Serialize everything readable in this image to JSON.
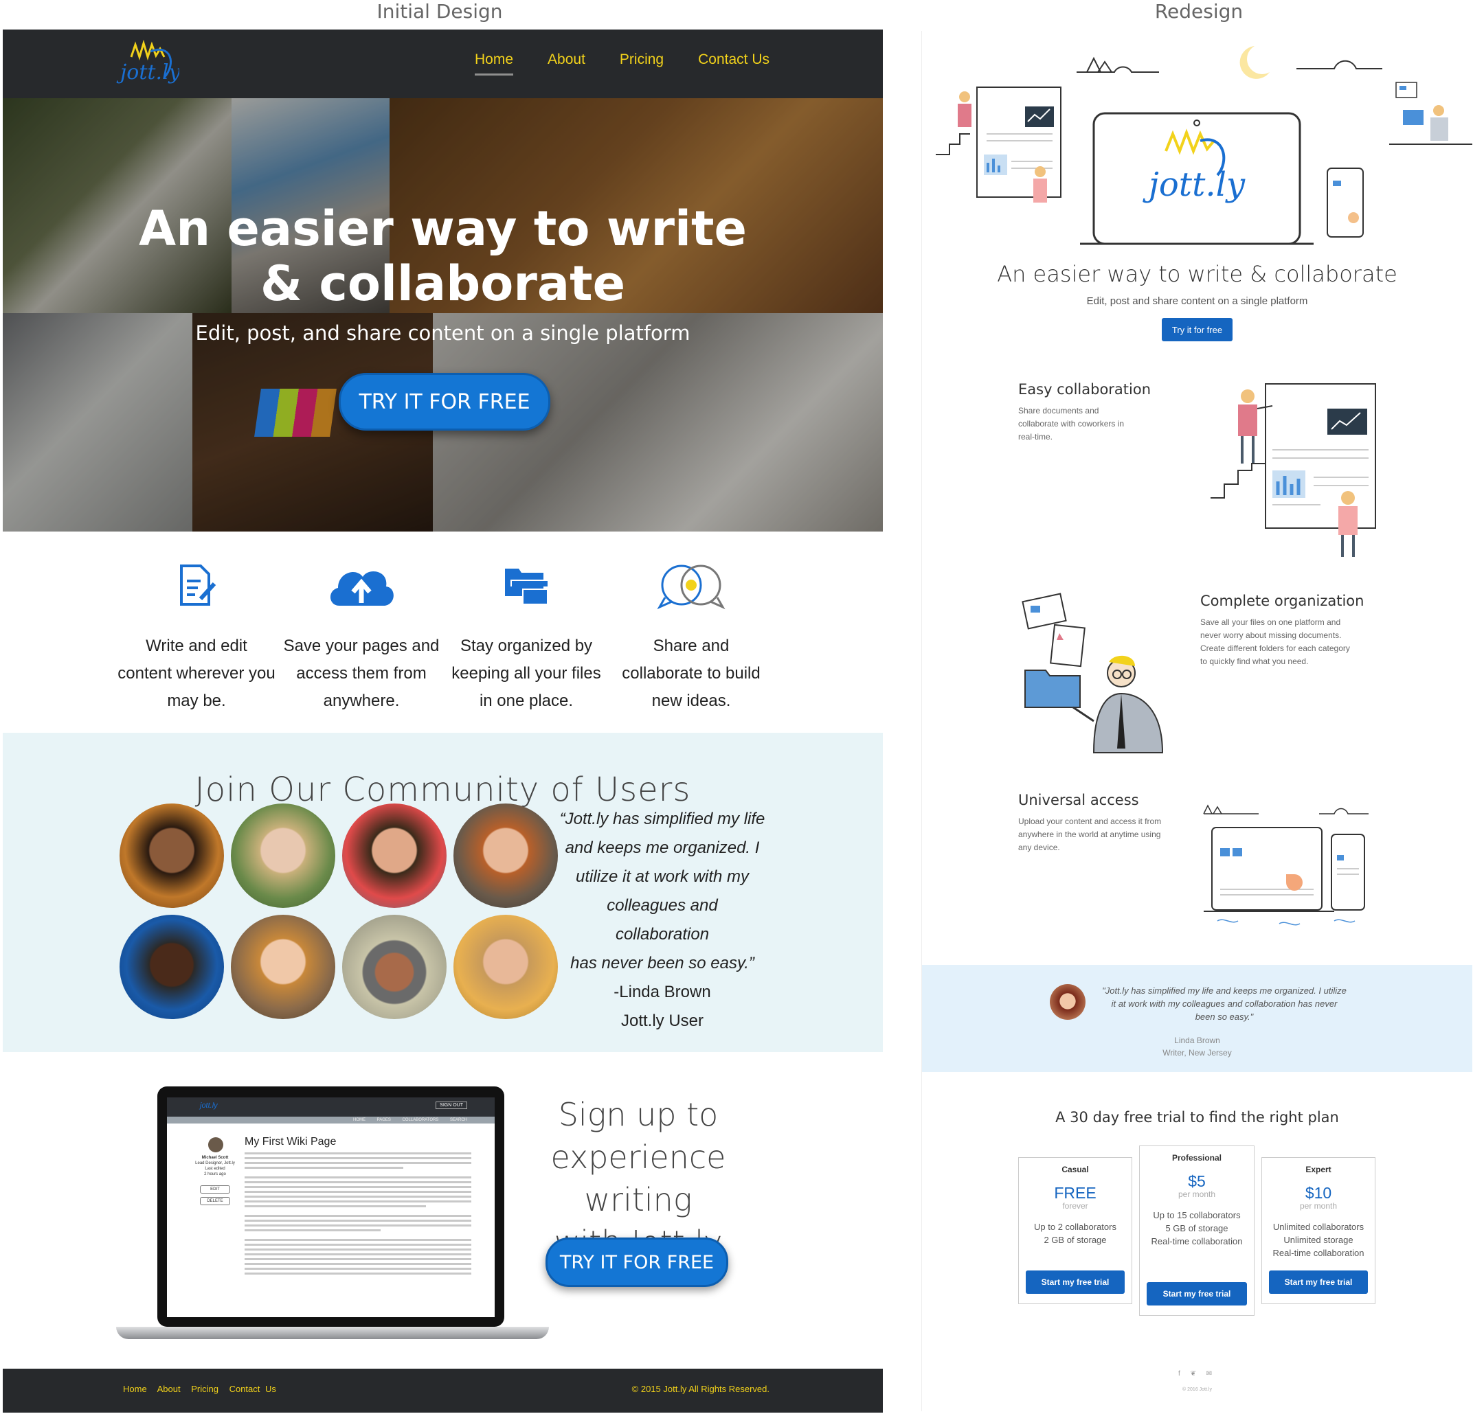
{
  "labels": {
    "initial": "Initial Design",
    "redesign": "Redesign"
  },
  "initial": {
    "logo_text": "jott.ly",
    "nav": [
      "Home",
      "About",
      "Pricing",
      "Contact Us"
    ],
    "hero": {
      "title_line1": "An easier way to write",
      "title_line2": "& collaborate",
      "subtitle": "Edit, post, and share content on a single platform",
      "cta": "TRY IT FOR FREE"
    },
    "features": [
      {
        "icon": "document-edit-icon",
        "text": "Write and edit content wherever you may be."
      },
      {
        "icon": "cloud-upload-icon",
        "text": "Save your pages and access them from anywhere."
      },
      {
        "icon": "folders-icon",
        "text": "Stay organized  by keeping all your files in one place."
      },
      {
        "icon": "chat-bubbles-idea-icon",
        "text": "Share and collaborate to build new ideas."
      }
    ],
    "community": {
      "title": "Join Our Community of Users",
      "quote_lines": [
        "“Jott.ly has simplified my life",
        "and keeps  me organized. I",
        "utilize it at work with my",
        "colleagues and collaboration",
        "has never been so easy.”"
      ],
      "author": "-Linda Brown",
      "role": "Jott.ly User"
    },
    "signup": {
      "title_lines": [
        "Sign up to",
        "experience writing",
        "with Jott.ly"
      ],
      "cta": "TRY IT FOR FREE",
      "screen": {
        "sign_out": "SIGN OUT",
        "menu": "HOME PAGES COLLABORATORS SEARCH",
        "page_title": "My First Wiki Page",
        "author": "Michael Scott",
        "author_role": "Lead Designer, Jott.ly",
        "edited_label": "Last edited",
        "edited_time": "2 hours ago",
        "edit": "EDIT",
        "delete": "DELETE"
      }
    },
    "footer": {
      "links": [
        "Home",
        "About",
        "Pricing",
        "Contact Us"
      ],
      "copyright": "© 2015 Jott.ly All Rights Reserved."
    }
  },
  "redesign": {
    "logo_text": "jott.ly",
    "hero": {
      "title": "An easier way to write & collaborate",
      "subtitle": "Edit, post and share content on a single platform",
      "cta": "Try it for free"
    },
    "sections": [
      {
        "title": "Easy collaboration",
        "body": "Share documents and collaborate with coworkers in real-time."
      },
      {
        "title": "Complete organization",
        "body": "Save all your files on one platform and never worry about missing documents. Create different folders for each category to quickly find what you need."
      },
      {
        "title": "Universal access",
        "body": "Upload your content and access it from anywhere in the world at anytime using any device."
      }
    ],
    "testimonial": {
      "quote": "\"Jott.ly has simplified my life and keeps me organized. I utilize it at work with my colleagues and collaboration has never been so easy.\"",
      "name": "Linda Brown",
      "role": "Writer, New Jersey"
    },
    "plans_title": "A 30 day free trial to find the right plan",
    "plans": [
      {
        "name": "Casual",
        "price": "FREE",
        "period": "forever",
        "features": [
          "Up to 2 collaborators",
          "2 GB of storage"
        ],
        "cta": "Start my free trial"
      },
      {
        "name": "Professional",
        "price": "$5",
        "period": "per month",
        "features": [
          "Up to 15 collaborators",
          "5 GB of storage",
          "Real-time collaboration"
        ],
        "cta": "Start my free trial"
      },
      {
        "name": "Expert",
        "price": "$10",
        "period": "per month",
        "features": [
          "Unlimited collaborators",
          "Unlimited storage",
          "Real-time collaboration"
        ],
        "cta": "Start my free trial"
      }
    ],
    "social": "f ❦ ✉",
    "copyright": "© 2016 Jott.ly"
  },
  "colors": {
    "accent_blue": "#1565c0",
    "nav_dark": "#27292c",
    "nav_link": "#f2d21b",
    "community_bg": "#e8f4f7",
    "quote_bg": "#e3f1fb"
  }
}
